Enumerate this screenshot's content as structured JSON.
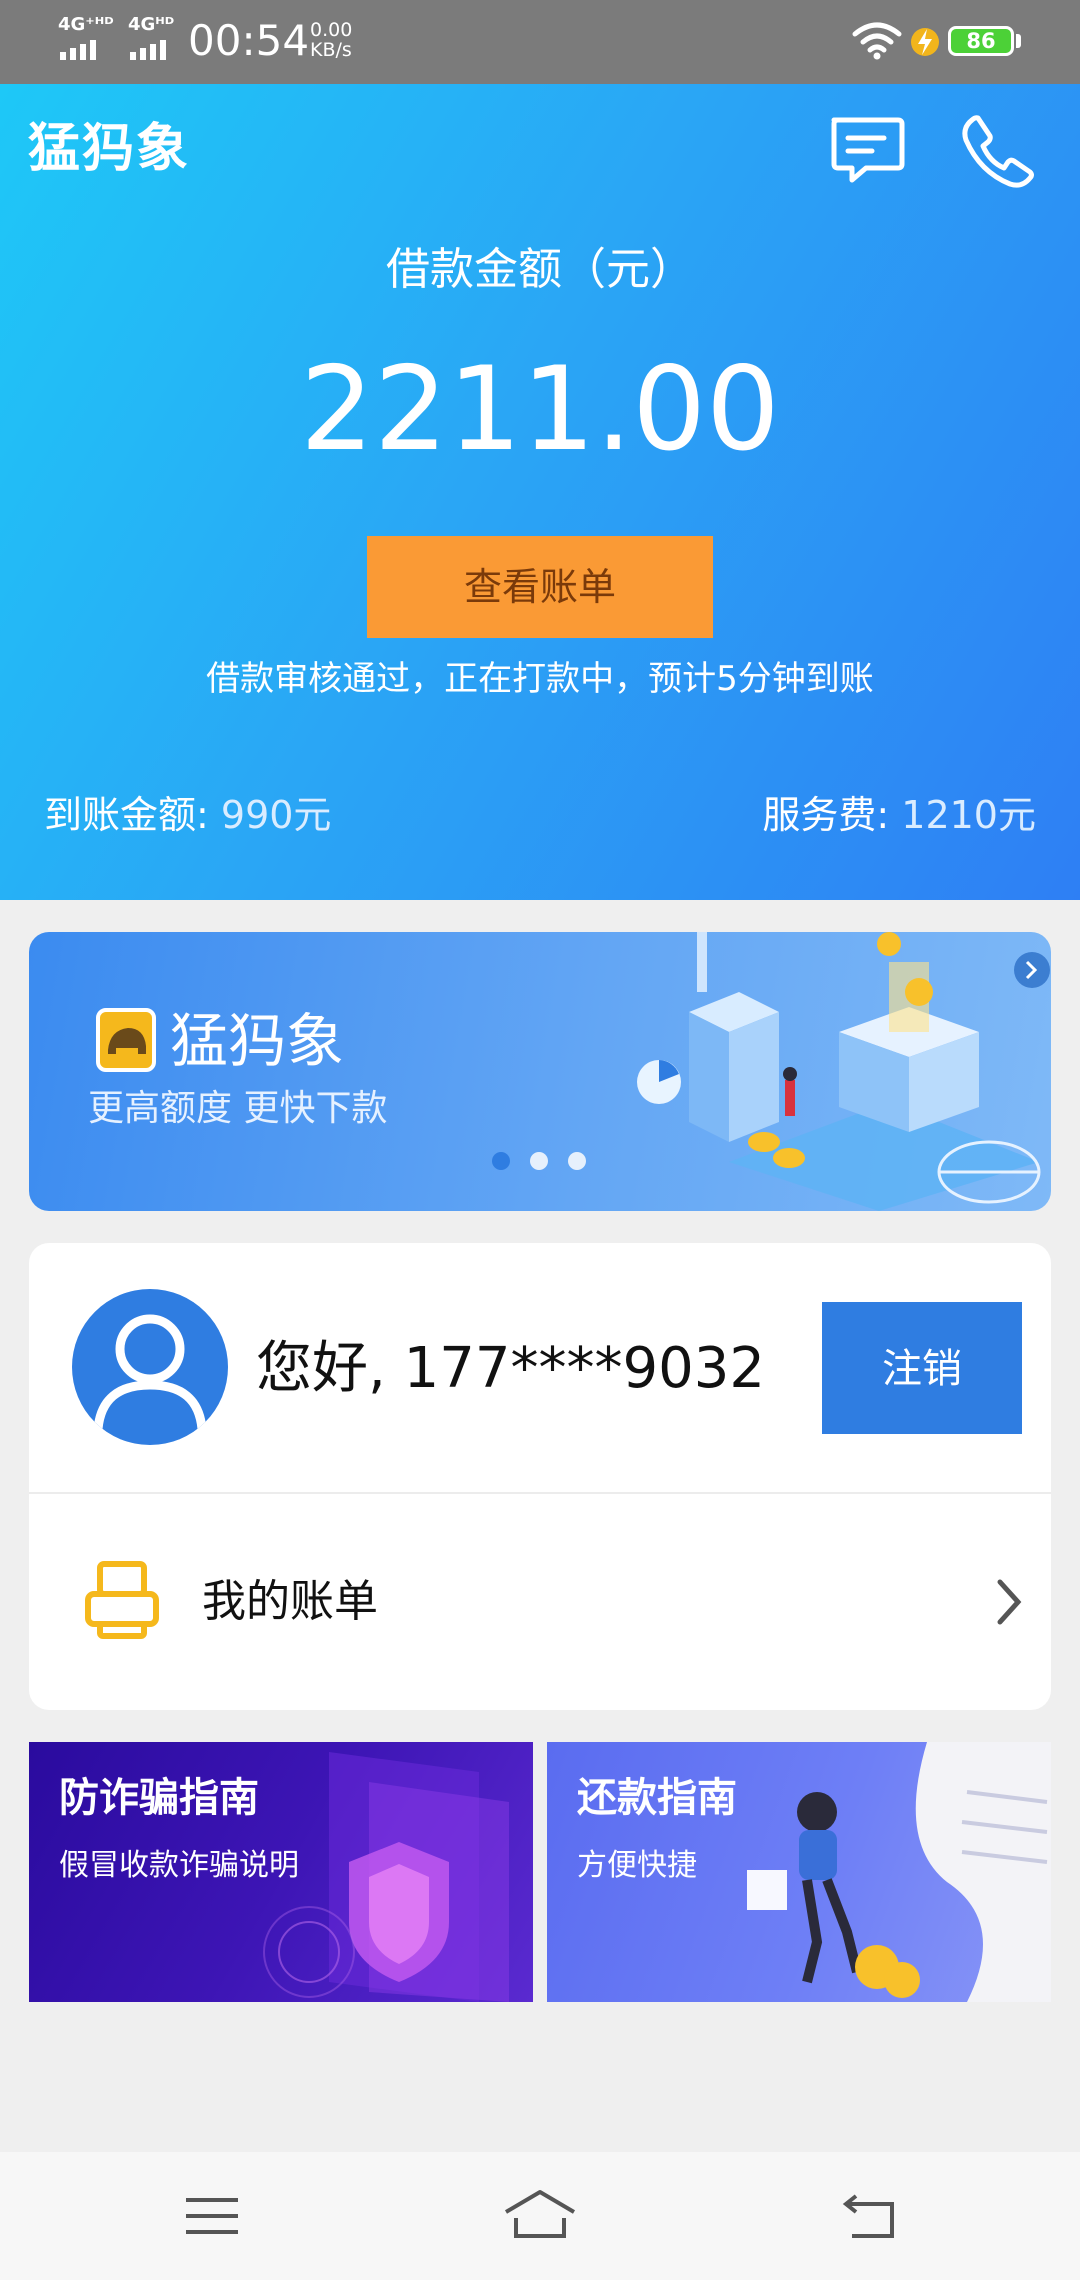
{
  "status_bar": {
    "network_1": "4G⁺ᴴᴰ",
    "network_2": "4Gᴴᴰ",
    "time": "00:54",
    "speed_value": "0.00",
    "speed_unit": "KB/s",
    "battery": "86"
  },
  "header": {
    "logo": "猛犸象",
    "message_icon": "message-icon",
    "phone_icon": "phone-icon"
  },
  "loan": {
    "label": "借款金额（元）",
    "amount": "2211.00",
    "view_bill_button": "查看账单",
    "status_text": "借款审核通过，正在打款中，预计5分钟到账",
    "received_label": "到账金额:",
    "received_value": "990元",
    "fee_label": "服务费:",
    "fee_value": "1210元"
  },
  "banner": {
    "title": "猛犸象",
    "subtitle": "更高额度 更快下款",
    "active_slide": 1,
    "slide_count": 3
  },
  "user": {
    "greeting": "您好, 177****9032",
    "logout_button": "注销",
    "my_bill_label": "我的账单"
  },
  "guides": [
    {
      "title": "防诈骗指南",
      "subtitle": "假冒收款诈骗说明"
    },
    {
      "title": "还款指南",
      "subtitle": "方便快捷"
    }
  ],
  "colors": {
    "primary": "#2f7de1",
    "accent_orange": "#fa9a35",
    "hero_gradient_start": "#1ec8f7",
    "hero_gradient_end": "#2e7ff4"
  }
}
